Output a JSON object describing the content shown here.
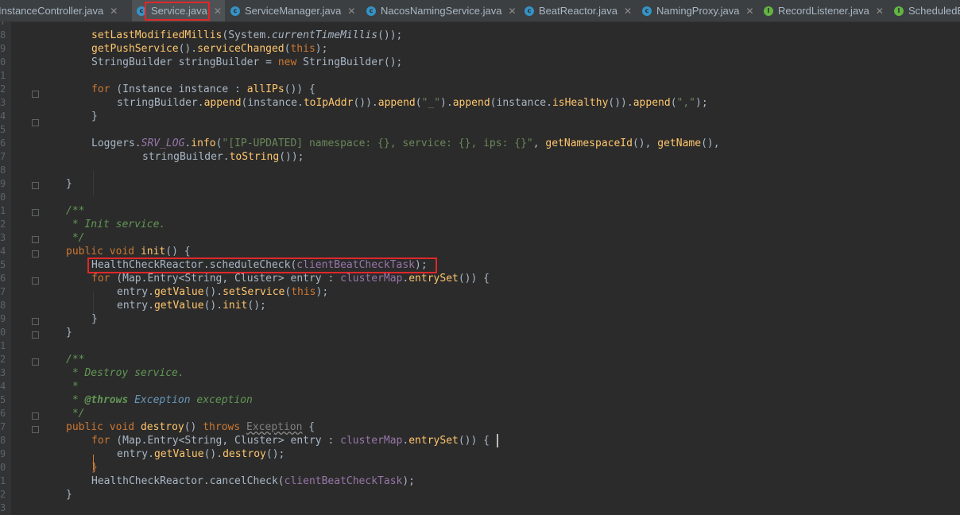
{
  "tabs": [
    {
      "label": "InstanceController.java",
      "icon": "class-icon",
      "active": false
    },
    {
      "label": "Service.java",
      "icon": "class-icon",
      "active": true
    },
    {
      "label": "ServiceManager.java",
      "icon": "class-icon",
      "active": false
    },
    {
      "label": "NacosNamingService.java",
      "icon": "class-icon",
      "active": false
    },
    {
      "label": "BeatReactor.java",
      "icon": "class-icon",
      "active": false
    },
    {
      "label": "NamingProxy.java",
      "icon": "class-icon",
      "active": false
    },
    {
      "label": "RecordListener.java",
      "icon": "interface-icon",
      "active": false
    },
    {
      "label": "ScheduledE",
      "icon": "interface-icon",
      "active": false
    }
  ],
  "line_numbers": [
    "7",
    "8",
    "9",
    "0",
    "1",
    "2",
    "3",
    "4",
    "5",
    "6",
    "7",
    "8",
    "9",
    "0",
    "1",
    "2",
    "3",
    "4",
    "5",
    "6",
    "7",
    "8",
    "9",
    "0",
    "1",
    "2",
    "3",
    "4",
    "5",
    "6",
    "7",
    "8",
    "9",
    "0",
    "1",
    "2",
    "3"
  ],
  "code": {
    "l1": "setLastModifiedMillis",
    "l1b": "(System.",
    "l1c": "currentTimeMillis",
    "l1d": "());",
    "l2a": "getPushService",
    "l2b": "().",
    "l2c": "serviceChanged",
    "l2d": "(",
    "l2e": "this",
    "l2f": ");",
    "l3a": "StringBuilder",
    "l3b": " stringBuilder = ",
    "l3c": "new",
    "l3d": " StringBuilder",
    "l3e": "();",
    "l5a": "for",
    "l5b": " (",
    "l5c": "Instance",
    "l5d": " instance : ",
    "l5e": "allIPs",
    "l5f": "()) {",
    "l6a": "stringBuilder.",
    "l6b": "append",
    "l6c": "(instance.",
    "l6d": "toIpAddr",
    "l6e": "()).",
    "l6f": "append",
    "l6g": "(",
    "l6h": "\"_\"",
    "l6i": ").",
    "l6j": "append",
    "l6k": "(instance.",
    "l6l": "isHealthy",
    "l6m": "()).",
    "l6n": "append",
    "l6o": "(",
    "l6p": "\",\"",
    "l6q": ");",
    "l7": "}",
    "l9a": "Loggers.",
    "l9b": "SRV_LOG",
    "l9c": ".",
    "l9d": "info",
    "l9e": "(",
    "l9f": "\"[IP-UPDATED] namespace: {}, service: {}, ips: {}\"",
    "l9g": ", ",
    "l9h": "getNamespaceId",
    "l9i": "(), ",
    "l9j": "getName",
    "l9k": "(),",
    "l10a": "stringBuilder.",
    "l10b": "toString",
    "l10c": "());",
    "l12": "}",
    "l14": "/**",
    "l15": " * Init service.",
    "l16": " */",
    "l17a": "public",
    "l17b": " ",
    "l17c": "void",
    "l17d": " ",
    "l17e": "init",
    "l17f": "() {",
    "l18a": "HealthCheckReactor",
    "l18b": ".scheduleCheck(",
    "l18c": "clientBeatCheckTask",
    "l18d": ");",
    "l19a": "for",
    "l19b": " (",
    "l19c": "Map.Entry",
    "l19d": "<",
    "l19e": "String",
    "l19f": ", ",
    "l19g": "Cluster",
    "l19h": "> entry : ",
    "l19i": "clusterMap",
    "l19j": ".",
    "l19k": "entrySet",
    "l19l": "()) {",
    "l20a": "entry.",
    "l20b": "getValue",
    "l20c": "().",
    "l20d": "setService",
    "l20e": "(",
    "l20f": "this",
    "l20g": ");",
    "l21a": "entry.",
    "l21b": "getValue",
    "l21c": "().",
    "l21d": "init",
    "l21e": "();",
    "l22": "}",
    "l23": "}",
    "l25": "/**",
    "l26": " * Destroy service.",
    "l27": " *",
    "l28a": " * ",
    "l28b": "@throws",
    "l28c": " Exception",
    "l28d": " exception",
    "l29": " */",
    "l30a": "public",
    "l30b": " ",
    "l30c": "void",
    "l30d": " ",
    "l30e": "destroy",
    "l30f": "() ",
    "l30g": "throws",
    "l30h": " ",
    "l30i": "Exception",
    "l30j": " {",
    "l31a": "for",
    "l31b": " (",
    "l31c": "Map.Entry",
    "l31d": "<",
    "l31e": "String",
    "l31f": ", ",
    "l31g": "Cluster",
    "l31h": "> entry : ",
    "l31i": "clusterMap",
    "l31j": ".",
    "l31k": "entrySet",
    "l31l": "()) {",
    "l32a": "entry.",
    "l32b": "getValue",
    "l32c": "().",
    "l32d": "destroy",
    "l32e": "();",
    "l33": "}",
    "l34a": "HealthCheckReactor",
    "l34b": ".cancelCheck(",
    "l34c": "clientBeatCheckTask",
    "l34d": ");",
    "l35": "}"
  },
  "colors": {
    "highlight": "#e0272a",
    "background": "#2b2b2b",
    "keyword": "#cc7832",
    "method": "#ffc66d",
    "string": "#6a8759",
    "field": "#9876aa"
  }
}
